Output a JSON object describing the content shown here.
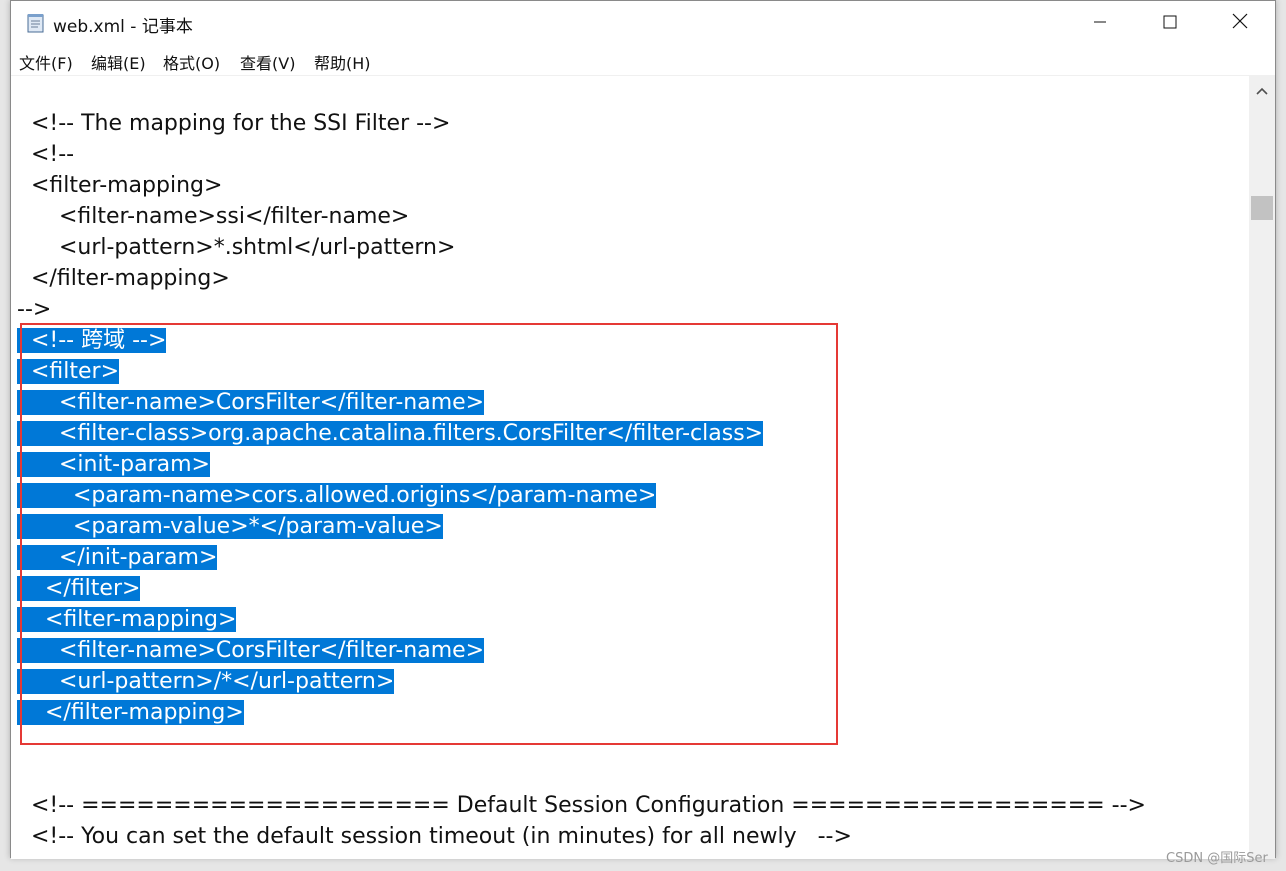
{
  "window": {
    "title": "web.xml - 记事本",
    "icon": "notepad-icon",
    "controls": {
      "minimize": "minimize-icon",
      "maximize": "maximize-icon",
      "close": "close-icon"
    }
  },
  "menu": {
    "items": [
      {
        "label": "文件(F)"
      },
      {
        "label": "编辑(E)"
      },
      {
        "label": "格式(O)"
      },
      {
        "label": "查看(V)"
      },
      {
        "label": "帮助(H)"
      }
    ]
  },
  "editor": {
    "lines": [
      {
        "text": "  <!-- The mapping for the SSI Filter -->",
        "selected": false
      },
      {
        "text": "  <!--",
        "selected": false
      },
      {
        "text": "  <filter-mapping>",
        "selected": false
      },
      {
        "text": "      <filter-name>ssi</filter-name>",
        "selected": false
      },
      {
        "text": "      <url-pattern>*.shtml</url-pattern>",
        "selected": false
      },
      {
        "text": "  </filter-mapping>",
        "selected": false
      },
      {
        "text": "-->",
        "selected": false
      },
      {
        "text": "  <!-- 跨域 -->",
        "selected": true
      },
      {
        "text": "  <filter>",
        "selected": true
      },
      {
        "text": "      <filter-name>CorsFilter</filter-name>",
        "selected": true
      },
      {
        "text": "      <filter-class>org.apache.catalina.filters.CorsFilter</filter-class>",
        "selected": true
      },
      {
        "text": "      <init-param>",
        "selected": true
      },
      {
        "text": "        <param-name>cors.allowed.origins</param-name>",
        "selected": true
      },
      {
        "text": "        <param-value>*</param-value>",
        "selected": true
      },
      {
        "text": "      </init-param>",
        "selected": true
      },
      {
        "text": "    </filter>",
        "selected": true
      },
      {
        "text": "    <filter-mapping>",
        "selected": true
      },
      {
        "text": "      <filter-name>CorsFilter</filter-name>",
        "selected": true
      },
      {
        "text": "      <url-pattern>/*</url-pattern>",
        "selected": true
      },
      {
        "text": "    </filter-mapping>",
        "selected": true
      },
      {
        "text": "",
        "selected": false
      },
      {
        "text": "",
        "selected": false
      },
      {
        "text": "  <!-- ==================== Default Session Configuration ================= -->",
        "selected": false
      },
      {
        "text": "  <!-- You can set the default session timeout (in minutes) for all newly   -->",
        "selected": false
      }
    ]
  },
  "scrollbar": {
    "up_icon": "scroll-up-arrow-icon"
  },
  "watermark": "CSDN @国际Ser",
  "colors": {
    "selection": "#0078d7",
    "highlight_border": "#e53935"
  }
}
